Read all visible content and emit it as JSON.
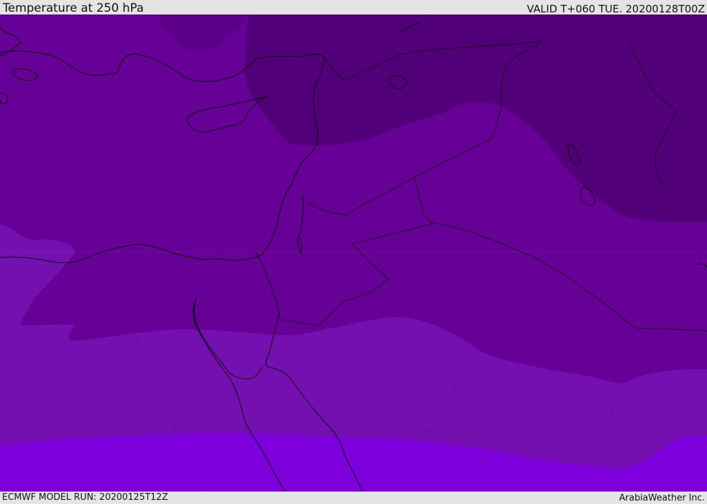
{
  "header": {
    "title": "Temperature at 250 hPa",
    "valid": "VALID T+060 TUE. 20200128T00Z"
  },
  "footer": {
    "model_run": "ECMWF MODEL RUN: 20200125T12Z",
    "credit": "ArabiaWeather Inc."
  },
  "colors": {
    "coldest_band": "#52007a",
    "cold_band": "#660096",
    "mid_band": "#7410b0",
    "warm_band": "#7d00dc",
    "coastline": "#000000"
  }
}
